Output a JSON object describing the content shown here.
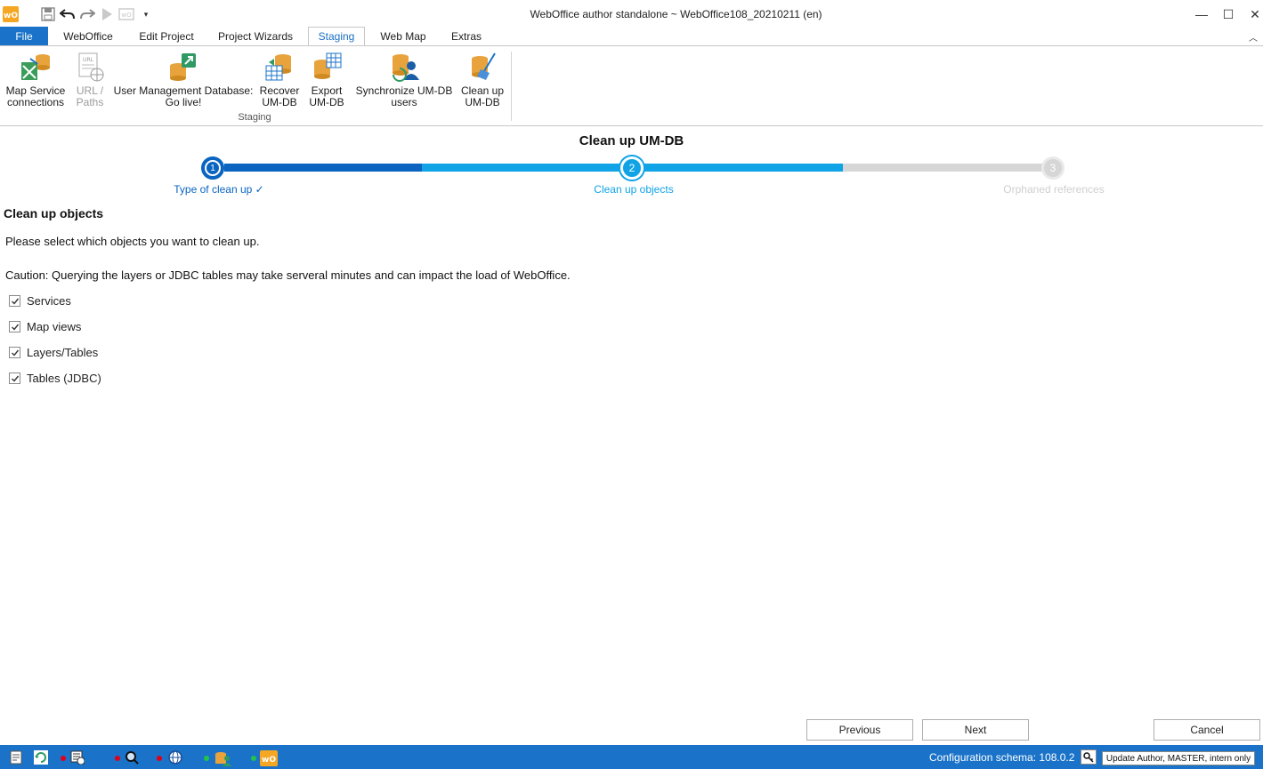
{
  "window": {
    "title": "WebOffice author standalone ~ WebOffice108_20210211 (en)",
    "app_icon": "webOffice-logo-icon",
    "quick_access": [
      "save-icon",
      "undo-icon",
      "redo-icon",
      "run-icon",
      "publish-icon",
      "customize-dropdown-icon"
    ],
    "controls": {
      "minimize": "—",
      "maximize": "☐",
      "close": "✕"
    }
  },
  "tabs": {
    "file": "File",
    "items": [
      "WebOffice",
      "Edit Project",
      "Project Wizards",
      "Staging",
      "Web Map",
      "Extras"
    ],
    "active": "Staging",
    "collapse": "︿"
  },
  "ribbon": {
    "group_label": "Staging",
    "buttons": [
      {
        "line1": "Map Service",
        "line2": "connections",
        "icon": "map-service-connections-icon",
        "enabled": true
      },
      {
        "line1": "URL /",
        "line2": "Paths",
        "icon": "url-paths-icon",
        "enabled": false
      },
      {
        "line1": "User Management Database:",
        "line2": "Go live!",
        "icon": "umdb-go-live-icon",
        "enabled": true
      },
      {
        "line1": "Recover",
        "line2": "UM-DB",
        "icon": "recover-umdb-icon",
        "enabled": true
      },
      {
        "line1": "Export",
        "line2": "UM-DB",
        "icon": "export-umdb-icon",
        "enabled": true
      },
      {
        "line1": "Synchronize UM-DB",
        "line2": "users",
        "icon": "synchronize-users-icon",
        "enabled": true
      },
      {
        "line1": "Clean up",
        "line2": "UM-DB",
        "icon": "clean-up-umdb-icon",
        "enabled": true
      }
    ]
  },
  "wizard": {
    "title": "Clean up UM-DB",
    "steps": [
      {
        "number": "1",
        "label": "Type of clean up ✓",
        "state": "done"
      },
      {
        "number": "2",
        "label": "Clean up objects",
        "state": "current"
      },
      {
        "number": "3",
        "label": "Orphaned references",
        "state": "pending"
      }
    ],
    "colors": {
      "done": "#0a64c0",
      "current": "#10a3e6",
      "pending": "#d6d6d6"
    }
  },
  "content": {
    "section_title": "Clean up objects",
    "intro": "Please select which objects you want to clean up.",
    "caution": "Caution: Querying the layers or JDBC tables may take serveral minutes and can impact the load of WebOffice.",
    "options": [
      {
        "label": "Services",
        "checked": true
      },
      {
        "label": "Map views",
        "checked": true
      },
      {
        "label": "Layers/Tables",
        "checked": true
      },
      {
        "label": "Tables (JDBC)",
        "checked": true
      }
    ]
  },
  "buttons": {
    "previous": "Previous",
    "next": "Next",
    "cancel": "Cancel"
  },
  "statusbar": {
    "schema": "Configuration schema: 108.0.2",
    "update": "Update Author, MASTER, intern only",
    "accent": "#1a73c8"
  }
}
